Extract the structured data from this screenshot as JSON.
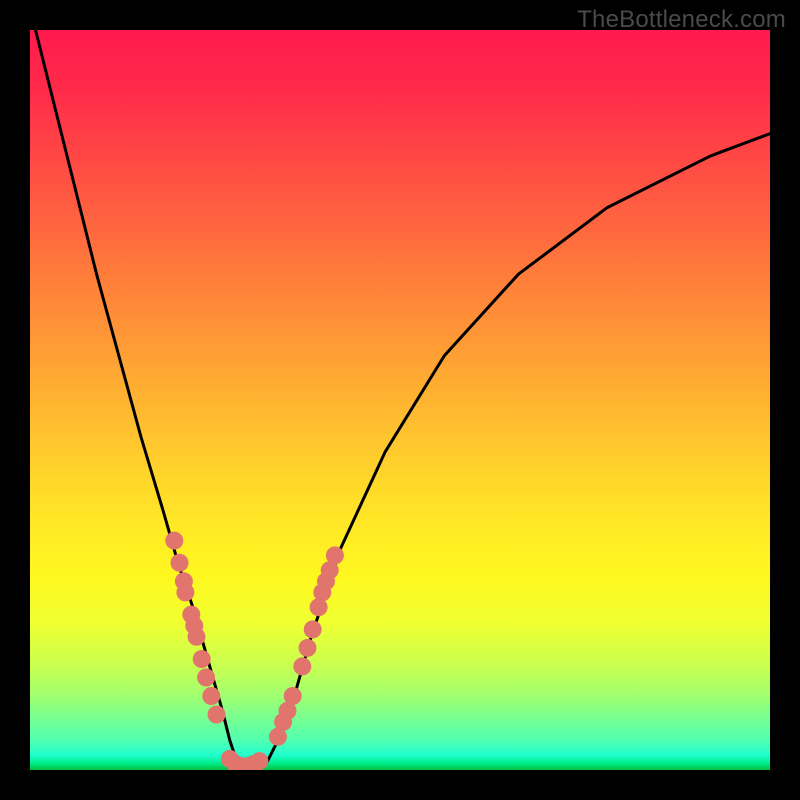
{
  "watermark": "TheBottleneck.com",
  "chart_data": {
    "type": "line",
    "title": "",
    "xlabel": "",
    "ylabel": "",
    "xlim": [
      0,
      100
    ],
    "ylim": [
      0,
      100
    ],
    "grid": false,
    "legend": false,
    "note": "V-shaped bottleneck curve; y approximates bottleneck % (0 is best, at valley floor). x is a relative hardware balance axis. Values estimated from pixel positions — no axes are shown.",
    "series": [
      {
        "name": "bottleneck-curve",
        "x": [
          0,
          3,
          6,
          9,
          12,
          15,
          18,
          20,
          22,
          24,
          26,
          27,
          28,
          29,
          30,
          32,
          34,
          36,
          38,
          42,
          48,
          56,
          66,
          78,
          92,
          100
        ],
        "y": [
          103,
          91,
          79,
          67,
          56,
          45,
          35,
          28,
          22,
          15,
          8,
          4,
          1,
          0,
          0,
          1,
          5,
          11,
          18,
          30,
          43,
          56,
          67,
          76,
          83,
          86
        ]
      }
    ],
    "markers": {
      "name": "gpu-points",
      "color": "#e2746e",
      "note": "Salmon dots clustered on both arms of the V near the valley; approximate positions.",
      "points": [
        {
          "x": 19.5,
          "y": 31
        },
        {
          "x": 20.2,
          "y": 28
        },
        {
          "x": 20.8,
          "y": 25.5
        },
        {
          "x": 21.0,
          "y": 24
        },
        {
          "x": 21.8,
          "y": 21
        },
        {
          "x": 22.2,
          "y": 19.5
        },
        {
          "x": 22.5,
          "y": 18
        },
        {
          "x": 23.2,
          "y": 15
        },
        {
          "x": 23.8,
          "y": 12.5
        },
        {
          "x": 24.5,
          "y": 10
        },
        {
          "x": 25.2,
          "y": 7.5
        },
        {
          "x": 27.0,
          "y": 1.5
        },
        {
          "x": 27.8,
          "y": 0.8
        },
        {
          "x": 28.6,
          "y": 0.5
        },
        {
          "x": 29.4,
          "y": 0.5
        },
        {
          "x": 30.2,
          "y": 0.8
        },
        {
          "x": 31.0,
          "y": 1.2
        },
        {
          "x": 33.5,
          "y": 4.5
        },
        {
          "x": 34.2,
          "y": 6.5
        },
        {
          "x": 34.8,
          "y": 8
        },
        {
          "x": 35.5,
          "y": 10
        },
        {
          "x": 36.8,
          "y": 14
        },
        {
          "x": 37.5,
          "y": 16.5
        },
        {
          "x": 38.2,
          "y": 19
        },
        {
          "x": 39.0,
          "y": 22
        },
        {
          "x": 39.5,
          "y": 24
        },
        {
          "x": 40.0,
          "y": 25.5
        },
        {
          "x": 40.5,
          "y": 27
        },
        {
          "x": 41.2,
          "y": 29
        }
      ]
    },
    "background_gradient": {
      "direction": "vertical",
      "stops": [
        {
          "pos": 0.0,
          "color": "#ff1a4d"
        },
        {
          "pos": 0.5,
          "color": "#ffc030"
        },
        {
          "pos": 0.8,
          "color": "#f0ff30"
        },
        {
          "pos": 1.0,
          "color": "#00c040"
        }
      ]
    }
  }
}
